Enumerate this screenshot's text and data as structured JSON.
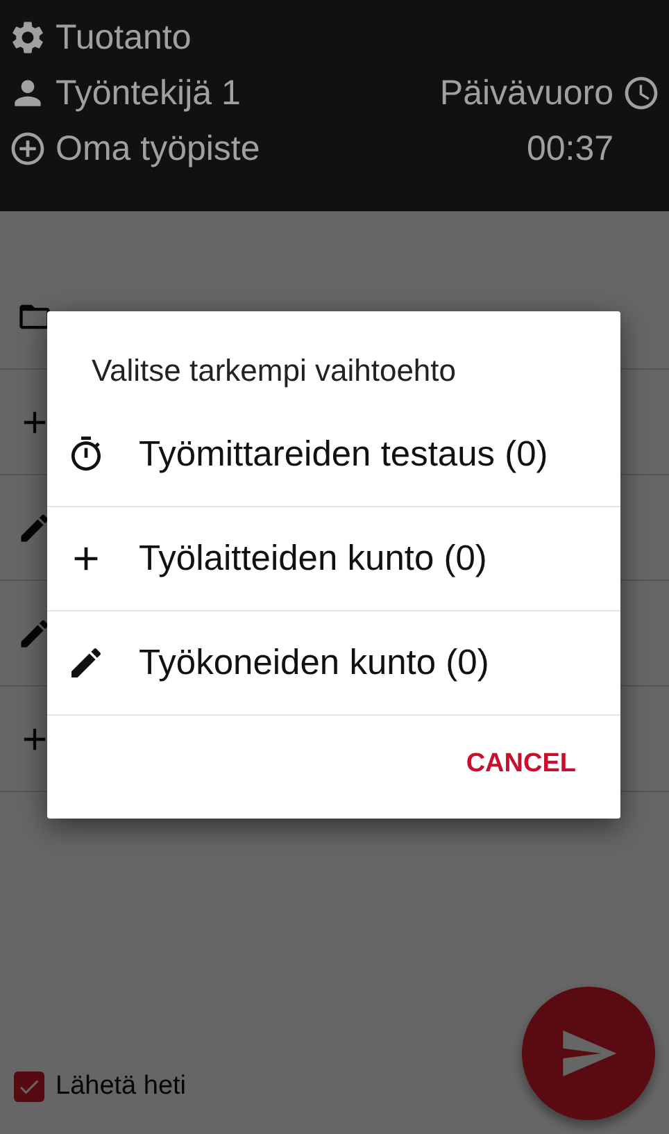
{
  "header": {
    "department": "Tuotanto",
    "worker": "Työntekijä 1",
    "workstation": "Oma työpiste",
    "shift": "Päivävuoro",
    "time": "00:37"
  },
  "list": [
    {
      "kind": "folder"
    },
    {
      "kind": "add"
    },
    {
      "kind": "edit"
    },
    {
      "kind": "edit"
    },
    {
      "kind": "add"
    }
  ],
  "send_now": {
    "label": "Lähetä heti",
    "checked": true
  },
  "dialog": {
    "title": "Valitse tarkempi vaihtoehto",
    "options": [
      {
        "kind": "timer",
        "label": "Työmittareiden testaus (0)"
      },
      {
        "kind": "add",
        "label": "Työlaitteiden kunto (0)"
      },
      {
        "kind": "edit",
        "label": "Työkoneiden kunto (0)"
      }
    ],
    "cancel": "CANCEL"
  }
}
